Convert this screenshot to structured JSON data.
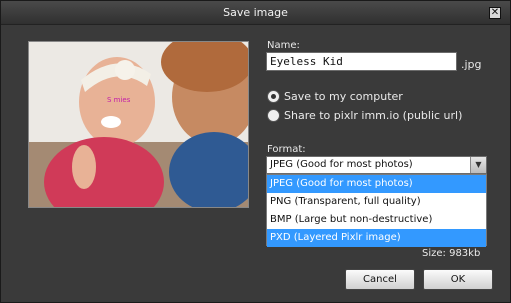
{
  "dialog": {
    "title": "Save image",
    "close_glyph": "✕"
  },
  "preview": {
    "overlay_text": "S  mies"
  },
  "name": {
    "label": "Name:",
    "value": "Eyeless Kid",
    "extension": ".jpg"
  },
  "destination": {
    "options": [
      {
        "label": "Save to my computer",
        "selected": true
      },
      {
        "label": "Share to pixlr imm.io (public url)",
        "selected": false
      }
    ]
  },
  "format": {
    "label": "Format:",
    "selected": "JPEG (Good for most photos)",
    "arrow_icon": "chevron-down-icon",
    "options": [
      {
        "label": "JPEG (Good for most photos)",
        "highlighted": true
      },
      {
        "label": "PNG (Transparent, full quality)",
        "highlighted": false
      },
      {
        "label": "BMP (Large but non-destructive)",
        "highlighted": false
      },
      {
        "label": "PXD (Layered Pixlr image)",
        "highlighted": true
      }
    ]
  },
  "size": {
    "label": "Size: 983kb"
  },
  "buttons": {
    "cancel": "Cancel",
    "ok": "OK"
  },
  "colors": {
    "dialog_bg": "#3a3a3a",
    "highlight": "#3399ff"
  }
}
